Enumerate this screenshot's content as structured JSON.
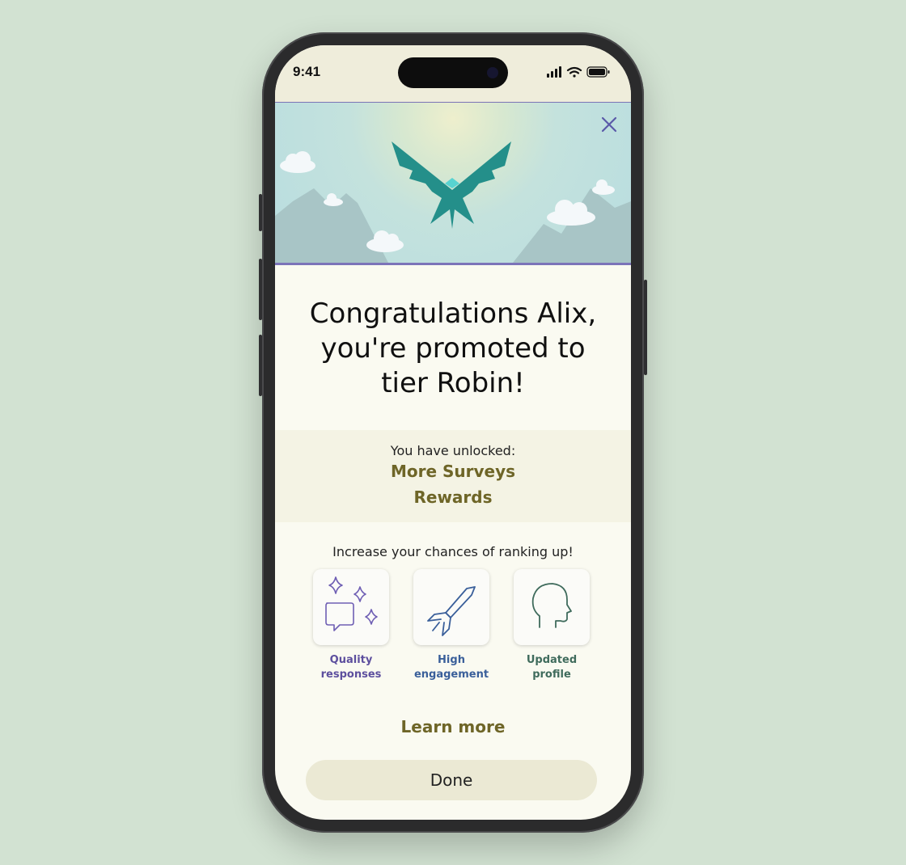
{
  "status_bar": {
    "time": "9:41"
  },
  "headline": "Congratulations Alix, you're promoted to tier Robin!",
  "unlocked": {
    "intro": "You have unlocked:",
    "items": [
      "More Surveys",
      "Rewards"
    ]
  },
  "tips": {
    "title": "Increase your chances of ranking up!",
    "items": [
      {
        "label": "Quality responses",
        "icon": "sparkle-chat-icon",
        "color": "#5d4f9e"
      },
      {
        "label": "High engagement",
        "icon": "rocket-icon",
        "color": "#3a5f9a"
      },
      {
        "label": "Updated profile",
        "icon": "head-profile-icon",
        "color": "#3f6b5c"
      }
    ]
  },
  "learn_more": "Learn more",
  "done": "Done",
  "colors": {
    "background": "#d2e2d2",
    "accent_gold": "#6e6527",
    "hero_border": "#7c74b9",
    "bird": "#248f8a"
  }
}
